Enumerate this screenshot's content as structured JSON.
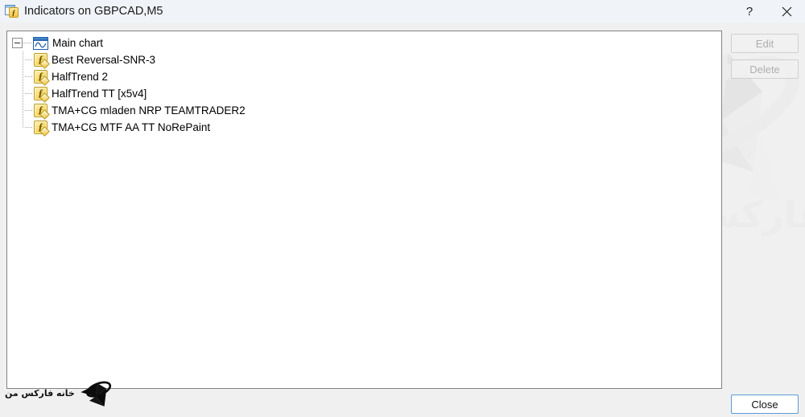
{
  "window": {
    "title": "Indicators on GBPCAD,M5",
    "icon": "indicators-window-icon",
    "help_label": "?",
    "close_glyph": "✕"
  },
  "tree": {
    "root": {
      "label": "Main chart",
      "icon": "chart-icon",
      "expanded": true,
      "expander_glyph": "−"
    },
    "items": [
      {
        "label": "Best Reversal-SNR-3",
        "icon": "function-icon",
        "glyph": "f"
      },
      {
        "label": "HalfTrend 2",
        "icon": "function-icon",
        "glyph": "f"
      },
      {
        "label": "HalfTrend TT [x5v4]",
        "icon": "function-icon",
        "glyph": "f"
      },
      {
        "label": "TMA+CG mladen NRP TEAMTRADER2",
        "icon": "function-icon",
        "glyph": "f"
      },
      {
        "label": "TMA+CG MTF AA TT NoRePaint",
        "icon": "function-icon",
        "glyph": "f"
      }
    ]
  },
  "buttons": {
    "edit": "Edit",
    "delete": "Delete",
    "close": "Close"
  },
  "watermark": {
    "text": "خانه فارکس من",
    "brand_text": "خانه فارکس من"
  },
  "colors": {
    "titlebar_bg": "#f0f3f7",
    "dialog_bg": "#f0f0f0",
    "panel_bg": "#ffffff",
    "panel_border": "#828282",
    "focus_border": "#5b9bd5",
    "disabled_text": "#b0aeb0",
    "icon_gold": "#f2c63f",
    "icon_blue": "#1f5fa9",
    "watermark_gray": "#ececec"
  }
}
